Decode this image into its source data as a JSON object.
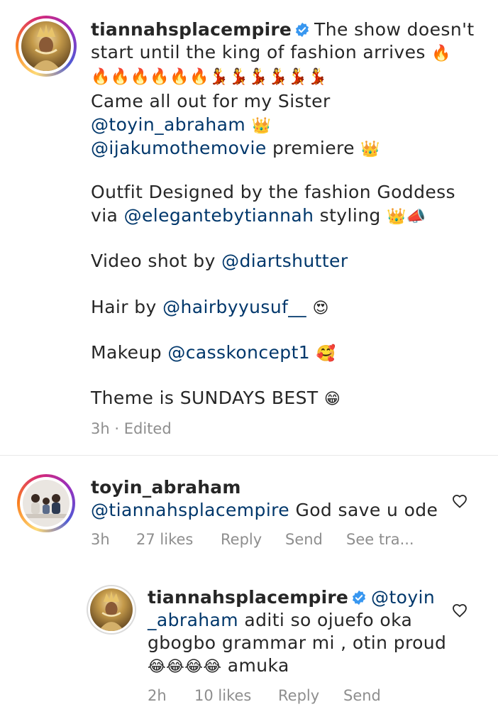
{
  "post": {
    "username": "tiannahsplacempire",
    "line1_text": "The show doesn't",
    "line2_text": "start until the king of fashion arrives",
    "line2_emoji": "🔥",
    "line3_emoji": "🔥🔥🔥🔥🔥🔥💃💃💃💃💃💃",
    "line4_text": "Came all out for my Sister",
    "line5_mention": "@toyin_abraham",
    "line5_emoji": "👑",
    "line6_mention": "@ijakumothemovie",
    "line6_text": " premiere",
    "line6_emoji": "👑",
    "line7_text": "Outfit Designed by the fashion Goddess",
    "line8_prefix": "via ",
    "line8_mention": "@elegantebytiannah",
    "line8_text": " styling",
    "line8_emoji": "👑📣",
    "line9_text": "Video shot by ",
    "line9_mention": "@diartshutter",
    "line10_text": "Hair by ",
    "line10_mention": "@hairbyyusuf__",
    "line10_emoji": "😍",
    "line11_text": "Makeup ",
    "line11_mention": "@casskoncept1",
    "line11_emoji": "🥰",
    "line12_text": "Theme is SUNDAYS BEST",
    "line12_emoji": "😁",
    "meta_time": "3h",
    "meta_sep": "·",
    "meta_edited": "Edited"
  },
  "comment1": {
    "username": "toyin_abraham",
    "mention": "@tiannahsplacempire",
    "text": " God save u ode",
    "time": "3h",
    "likes": "27 likes",
    "reply": "Reply",
    "send": "Send",
    "see_translation": "See tra..."
  },
  "reply1": {
    "username": "tiannahsplacempire",
    "line1_mention": "@toyin",
    "line2_mention": "_abraham",
    "line2_text": " aditi so ojuefo oka",
    "line3_text": "gbogbo grammar mi , otin proud",
    "line4_emoji": "😂😂😂😂",
    "line4_text": " amuka",
    "time": "2h",
    "likes": "10 likes",
    "reply": "Reply",
    "send": "Send"
  },
  "colors": {
    "text": "#262626",
    "mention": "#00376b",
    "meta": "#8e8e8e",
    "verified": "#3897f0"
  },
  "icons": {
    "verified": "verified-badge-icon",
    "heart": "heart-outline-icon"
  }
}
